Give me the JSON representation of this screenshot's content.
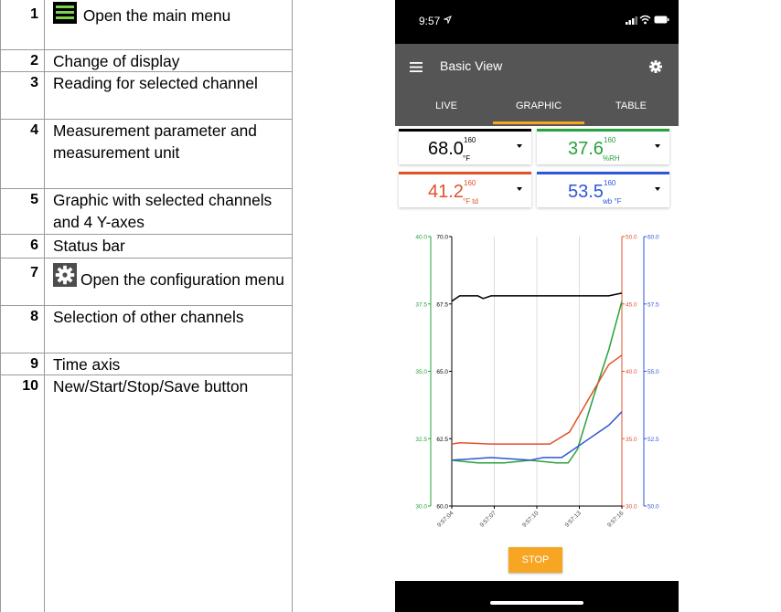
{
  "legend": [
    {
      "num": "1",
      "text": "Open the main menu",
      "icon": "menu-icon"
    },
    {
      "num": "2",
      "text": "Change of display"
    },
    {
      "num": "3",
      "text": "Reading for selected channel"
    },
    {
      "num": "4",
      "text": "Measurement parameter and measurement unit"
    },
    {
      "num": "5",
      "text": "Graphic with selected channels and 4 Y-axes"
    },
    {
      "num": "6",
      "text": "Status bar"
    },
    {
      "num": "7",
      "text": "Open the configuration menu",
      "icon": "gear-icon"
    },
    {
      "num": "8",
      "text": "Selection of other channels"
    },
    {
      "num": "9",
      "text": "Time axis"
    },
    {
      "num": "10",
      "text": "New/Start/Stop/Save button"
    }
  ],
  "phone": {
    "status_time": "9:57",
    "title": "Basic View",
    "tabs": [
      "LIVE",
      "GRAPHIC",
      "TABLE"
    ],
    "active_tab": "GRAPHIC",
    "accent_color": "#f6a623",
    "channels": [
      {
        "value": "68.0",
        "sup": "160",
        "unit": "°F",
        "color": "#000000"
      },
      {
        "value": "37.6",
        "sup": "160",
        "unit": "%RH",
        "color": "#27a23a"
      },
      {
        "value": "41.2",
        "sup": "160",
        "unit": "°F td",
        "color": "#e0522b"
      },
      {
        "value": "53.5",
        "sup": "160",
        "unit": "wb °F",
        "color": "#2f56d8"
      }
    ],
    "stop_label": "STOP"
  },
  "chart_data": {
    "type": "line",
    "x": [
      "9:57:04",
      "9:57:07",
      "9:57:10",
      "9:57:13",
      "9:57:16"
    ],
    "axes": [
      {
        "id": "green",
        "color": "#27a23a",
        "ticks": [
          "40.0",
          "37.5",
          "35.0",
          "32.5",
          "30.0"
        ],
        "range": [
          30.0,
          40.0
        ]
      },
      {
        "id": "black",
        "color": "#000000",
        "ticks": [
          "70.0",
          "67.5",
          "65.0",
          "62.5",
          "60.0"
        ],
        "range": [
          60.0,
          70.0
        ]
      },
      {
        "id": "red",
        "color": "#e0522b",
        "ticks": [
          "50.0",
          "45.0",
          "40.0",
          "35.0",
          "30.0"
        ],
        "range": [
          30.0,
          50.0
        ]
      },
      {
        "id": "blue",
        "color": "#2f56d8",
        "ticks": [
          "60.0",
          "57.5",
          "55.0",
          "52.5",
          "50.0"
        ],
        "range": [
          50.0,
          60.0
        ]
      }
    ],
    "series": [
      {
        "axis": "black",
        "color": "#000000",
        "points": [
          [
            0,
            67.6
          ],
          [
            0.6,
            67.8
          ],
          [
            2.0,
            67.8
          ],
          [
            2.4,
            67.7
          ],
          [
            3,
            67.8
          ],
          [
            6,
            67.8
          ],
          [
            12,
            67.8
          ],
          [
            13,
            67.9
          ]
        ]
      },
      {
        "axis": "green",
        "color": "#27a23a",
        "points": [
          [
            0,
            31.7
          ],
          [
            2,
            31.6
          ],
          [
            4,
            31.6
          ],
          [
            6,
            31.7
          ],
          [
            8,
            31.6
          ],
          [
            8.9,
            31.6
          ],
          [
            9.6,
            32.1
          ],
          [
            10.8,
            34.0
          ],
          [
            12,
            35.8
          ],
          [
            13,
            37.6
          ]
        ]
      },
      {
        "axis": "red",
        "color": "#e0522b",
        "points": [
          [
            0,
            34.6
          ],
          [
            0.6,
            34.7
          ],
          [
            3,
            34.6
          ],
          [
            7.5,
            34.6
          ],
          [
            9,
            35.5
          ],
          [
            10.5,
            38.0
          ],
          [
            12,
            40.5
          ],
          [
            13,
            41.2
          ]
        ]
      },
      {
        "axis": "blue",
        "color": "#2f56d8",
        "points": [
          [
            0,
            51.7
          ],
          [
            3,
            51.8
          ],
          [
            6,
            51.7
          ],
          [
            7,
            51.8
          ],
          [
            8.4,
            51.8
          ],
          [
            9.6,
            52.2
          ],
          [
            12,
            53.0
          ],
          [
            13,
            53.5
          ]
        ]
      }
    ],
    "x_span": [
      0,
      13
    ]
  }
}
